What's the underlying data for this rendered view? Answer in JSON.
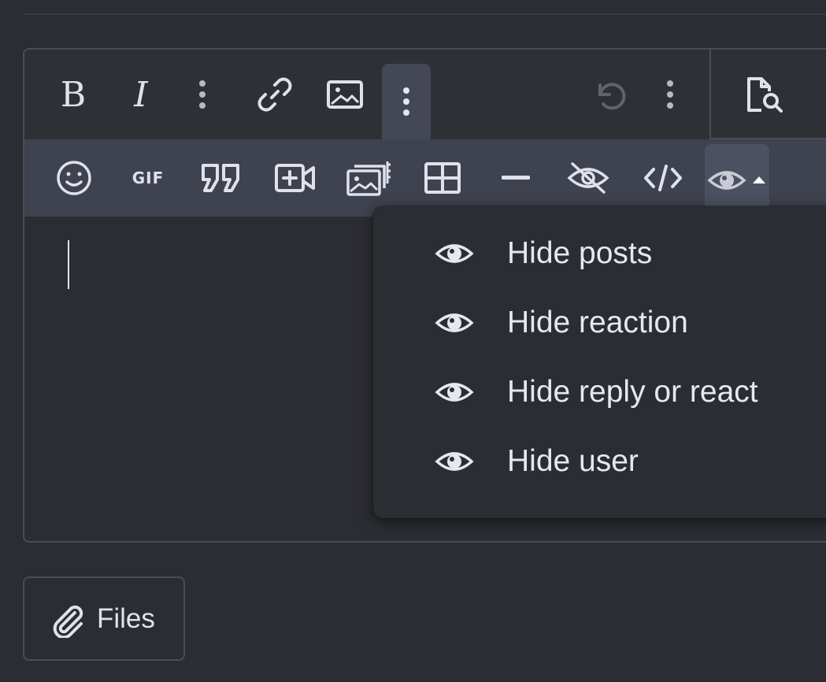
{
  "toolbar": {
    "bold": {
      "label": "B",
      "icon": "bold-icon"
    },
    "italic": {
      "label": "I",
      "icon": "italic-icon"
    },
    "more_text": {
      "icon": "more-vertical-icon"
    },
    "link": {
      "icon": "link-icon"
    },
    "image": {
      "icon": "image-icon"
    },
    "more_insert": {
      "icon": "more-vertical-icon"
    },
    "undo": {
      "icon": "undo-icon"
    },
    "more_options": {
      "icon": "more-vertical-icon"
    },
    "preview": {
      "icon": "preview-icon"
    }
  },
  "subtoolbar": {
    "items": [
      {
        "name": "emoji",
        "icon": "emoji-icon"
      },
      {
        "name": "gif",
        "icon": "gif-icon",
        "label": "GIF"
      },
      {
        "name": "quote",
        "icon": "quote-icon"
      },
      {
        "name": "media",
        "icon": "video-plus-icon"
      },
      {
        "name": "gallery",
        "icon": "gallery-icon"
      },
      {
        "name": "table",
        "icon": "table-icon"
      },
      {
        "name": "horizontal-rule",
        "icon": "minus-icon"
      },
      {
        "name": "spoiler",
        "icon": "eye-slash-icon"
      },
      {
        "name": "code",
        "icon": "code-icon"
      },
      {
        "name": "hide",
        "icon": "eye-icon"
      }
    ]
  },
  "hide_menu": {
    "items": [
      {
        "label": "Hide posts",
        "icon": "eye-icon"
      },
      {
        "label": "Hide reaction",
        "icon": "eye-icon"
      },
      {
        "label": "Hide reply or react",
        "icon": "eye-icon"
      },
      {
        "label": "Hide user",
        "icon": "eye-icon"
      }
    ]
  },
  "attach": {
    "label": "Files",
    "icon": "paperclip-icon"
  },
  "colors": {
    "background": "#2c2d32",
    "toolbar_sub": "#3f4350",
    "active_button": "#434756",
    "text": "#dfe2ea"
  }
}
